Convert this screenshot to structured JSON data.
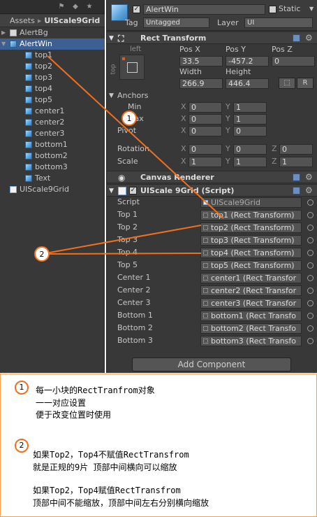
{
  "hierarchy": {
    "breadcrumb": {
      "root": "Assets",
      "separator": "▸",
      "current": "UIScale9Grid"
    },
    "items": [
      {
        "label": "AlertBg",
        "icon": "folder-icon",
        "arrow": "▶",
        "indent": 0,
        "selected": false
      },
      {
        "label": "AlertWin",
        "icon": "cube-icon",
        "arrow": "▼",
        "indent": 0,
        "selected": true
      },
      {
        "label": "top1",
        "icon": "cube-icon",
        "indent": 1
      },
      {
        "label": "top2",
        "icon": "cube-icon",
        "indent": 1
      },
      {
        "label": "top3",
        "icon": "cube-icon",
        "indent": 1
      },
      {
        "label": "top4",
        "icon": "cube-icon",
        "indent": 1
      },
      {
        "label": "top5",
        "icon": "cube-icon",
        "indent": 1
      },
      {
        "label": "center1",
        "icon": "cube-icon",
        "indent": 1
      },
      {
        "label": "center2",
        "icon": "cube-icon",
        "indent": 1
      },
      {
        "label": "center3",
        "icon": "cube-icon",
        "indent": 1
      },
      {
        "label": "bottom1",
        "icon": "cube-icon",
        "indent": 1
      },
      {
        "label": "bottom2",
        "icon": "cube-icon",
        "indent": 1
      },
      {
        "label": "bottom3",
        "icon": "cube-icon",
        "indent": 1
      },
      {
        "label": "Text",
        "icon": "cube-icon",
        "indent": 1
      },
      {
        "label": "UIScale9Grid",
        "icon": "script-icon",
        "indent": 0
      }
    ]
  },
  "inspector": {
    "object_name": "AlertWin",
    "static_label": "Static",
    "tag_label": "Tag",
    "tag_value": "Untagged",
    "layer_label": "Layer",
    "layer_value": "UI",
    "rect_transform": {
      "title": "Rect Transform",
      "anchor_preset_top": "left",
      "anchor_preset_side": "top",
      "pos_x_label": "Pos X",
      "pos_y_label": "Pos Y",
      "pos_z_label": "Pos Z",
      "pos_x": "33.5",
      "pos_y": "-457.2",
      "pos_z": "0",
      "width_label": "Width",
      "height_label": "Height",
      "width": "266.9",
      "height": "446.4",
      "r_button": "R",
      "anchors_label": "Anchors",
      "min_label": "Min",
      "max_label": "Max",
      "pivot_label": "Pivot",
      "min_x": "0",
      "min_y": "1",
      "max_x": "0",
      "max_y": "1",
      "pivot_x": "0",
      "pivot_y": "0",
      "rotation_label": "Rotation",
      "scale_label": "Scale",
      "rot_x": "0",
      "rot_y": "0",
      "rot_z": "0",
      "scale_x": "1",
      "scale_y": "1",
      "scale_z": "1",
      "x": "X",
      "y": "Y",
      "z": "Z"
    },
    "canvas_renderer_title": "Canvas Renderer",
    "script_component": {
      "title": "UIScale 9Grid (Script)",
      "script_label": "Script",
      "script_value": "UIScale9Grid",
      "fields": [
        {
          "label": "Top 1",
          "value": "top1 (Rect Transform)"
        },
        {
          "label": "Top 2",
          "value": "top2 (Rect Transform)"
        },
        {
          "label": "Top 3",
          "value": "top3 (Rect Transform)"
        },
        {
          "label": "Top 4",
          "value": "top4 (Rect Transform)"
        },
        {
          "label": "Top 5",
          "value": "top5 (Rect Transform)"
        },
        {
          "label": "Center 1",
          "value": "center1 (Rect Transfor"
        },
        {
          "label": "Center 2",
          "value": "center2 (Rect Transfor"
        },
        {
          "label": "Center 3",
          "value": "center3 (Rect Transfor"
        },
        {
          "label": "Bottom 1",
          "value": "bottom1 (Rect Transfo"
        },
        {
          "label": "Bottom 2",
          "value": "bottom2 (Rect Transfo"
        },
        {
          "label": "Bottom 3",
          "value": "bottom3 (Rect Transfo"
        }
      ]
    },
    "add_component": "Add Component"
  },
  "annotations": {
    "badge1": "1",
    "badge2": "2",
    "note1_line1": "每一小块的RectTranfrom对象",
    "note1_line2": "一一对应设置",
    "note1_line3": "便于改变位置时使用",
    "note2_line1": "如果Top2，Top4不赋值RectTransfrom",
    "note2_line2": "就是正规的9片   顶部中间横向可以缩放",
    "note2_line3": "如果Top2，Top4赋值RectTransfrom",
    "note2_line4": "顶部中间不能缩放，顶部中间左右分别横向缩放",
    "arrow_color": "#f07020"
  }
}
